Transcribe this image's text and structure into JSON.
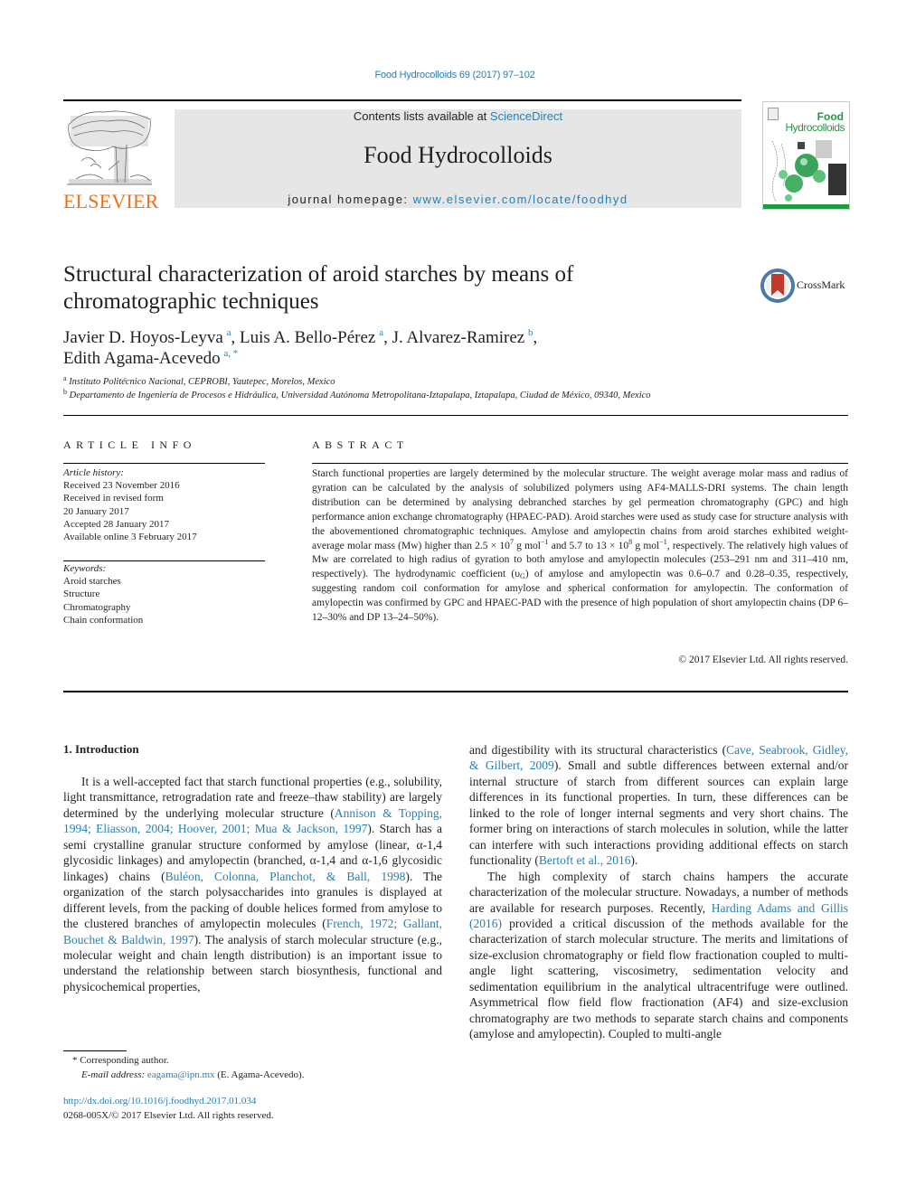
{
  "header": {
    "citation": "Food Hydrocolloids 69 (2017) 97–102",
    "contents_prefix": "Contents lists available at ",
    "contents_link": "ScienceDirect",
    "journal_title": "Food Hydrocolloids",
    "homepage_prefix": "journal homepage: ",
    "homepage_link": "www.elsevier.com/locate/foodhyd",
    "publisher_logo": "ELSEVIER",
    "cover_title_line1": "Food",
    "cover_title_line2": "Hydrocolloids",
    "crossmark_label": "CrossMark"
  },
  "colors": {
    "link": "#2a7fb0",
    "elsevier_orange": "#e9711c",
    "journal_box": "#e6e6e6",
    "cover_green": "#1f9a3c",
    "crossmark_red": "#c0392b"
  },
  "article": {
    "title": "Structural characterization of aroid starches by means of chromatographic techniques",
    "authors": [
      {
        "name": "Javier D. Hoyos-Leyva",
        "aff": "a",
        "sep": ", "
      },
      {
        "name": "Luis A. Bello-Pérez",
        "aff": "a",
        "sep": ", "
      },
      {
        "name": "J. Alvarez-Ramirez",
        "aff": "b",
        "sep": ","
      },
      {
        "name": "Edith Agama-Acevedo",
        "aff": "a, *",
        "sep": ""
      }
    ],
    "affiliations": [
      {
        "key": "a",
        "text": "Instituto Politécnico Nacional, CEPROBI, Yautepec, Morelos, Mexico"
      },
      {
        "key": "b",
        "text": "Departamento de Ingeniería de Procesos e Hidráulica, Universidad Autónoma Metropolitana-Iztapalapa, Iztapalapa, Ciudad de México, 09340, Mexico"
      }
    ]
  },
  "article_info": {
    "heading": "ARTICLE INFO",
    "history_label": "Article history:",
    "history": [
      "Received 23 November 2016",
      "Received in revised form",
      "20 January 2017",
      "Accepted 28 January 2017",
      "Available online 3 February 2017"
    ],
    "keywords_label": "Keywords:",
    "keywords": [
      "Aroid starches",
      "Structure",
      "Chromatography",
      "Chain conformation"
    ]
  },
  "abstract": {
    "heading": "ABSTRACT",
    "part1": "Starch functional properties are largely determined by the molecular structure. The weight average molar mass and radius of gyration can be calculated by the analysis of solubilized polymers using AF4-MALLS-DRI systems. The chain length distribution can be determined by analysing debranched starches by gel permeation chromatography (GPC) and high performance anion exchange chromatography (HPAEC-PAD). Aroid starches were used as study case for structure analysis with the abovementioned chromatographic techniques. Amylose and amylopectin chains from aroid starches exhibited weight-average molar mass (Mw) higher than 2.5 × 10",
    "exp1": "7",
    "part2": " g mol",
    "exp2": "−1",
    "part3": " and 5.7 to 13 × 10",
    "exp3": "8",
    "part4": " g mol",
    "exp4": "−1",
    "part5": ", respectively. The relatively high values of Mw are correlated to high radius of gyration to both amylose and amylopectin molecules (253–291 nm and 311–410 nm, respectively). The hydrodynamic coefficient (υ",
    "sub1": "G",
    "part6": ") of amylose and amylopectin was 0.6–0.7 and 0.28–0.35, respectively, suggesting random coil conformation for amylose and spherical conformation for amylopectin. The conformation of amylopectin was confirmed by GPC and HPAEC-PAD with the presence of high population of short amylopectin chains (DP 6–12–30% and DP 13–24–50%).",
    "copyright": "© 2017 Elsevier Ltd. All rights reserved."
  },
  "body": {
    "section_heading": "1.  Introduction",
    "left": {
      "t1": "It is a well-accepted fact that starch functional properties (e.g., solubility, light transmittance, retrogradation rate and freeze–thaw stability) are largely determined by the underlying molecular structure (",
      "c1": "Annison & Topping, 1994; Eliasson, 2004; Hoover, 2001; Mua & Jackson, 1997",
      "t2": "). Starch has a semi crystalline granular structure conformed by amylose (linear, α-1,4 glycosidic linkages) and amylopectin (branched, α-1,4 and α-1,6 glycosidic linkages) chains (",
      "c2": "Buléon, Colonna, Planchot, & Ball, 1998",
      "t3": "). The organization of the starch polysaccharides into granules is displayed at different levels, from the packing of double helices formed from amylose to the clustered branches of amylopectin molecules (",
      "c3": "French, 1972; Gallant, Bouchet & Baldwin, 1997",
      "t4": "). The analysis of starch molecular structure (e.g., molecular weight and chain length distribution) is an important issue to understand the relationship between starch biosynthesis, functional and physicochemical properties,"
    },
    "right": {
      "p1_t1": "and digestibility with its structural characteristics (",
      "p1_c1": "Cave, Seabrook, Gidley, & Gilbert, 2009",
      "p1_t2": "). Small and subtle differences between external and/or internal structure of starch from different sources can explain large differences in its functional properties. In turn, these differences can be linked to the role of longer internal segments and very short chains. The former bring on interactions of starch molecules in solution, while the latter can interfere with such interactions providing additional effects on starch functionality (",
      "p1_c2": "Bertoft et al., 2016",
      "p1_t3": ").",
      "p2_t1": "The high complexity of starch chains hampers the accurate characterization of the molecular structure. Nowadays, a number of methods are available for research purposes. Recently, ",
      "p2_c1": "Harding Adams and Gillis (2016)",
      "p2_t2": " provided a critical discussion of the methods available for the characterization of starch molecular structure. The merits and limitations of size-exclusion chromatography or field flow fractionation coupled to multi-angle light scattering, viscosimetry, sedimentation velocity and sedimentation equilibrium in the analytical ultracentrifuge were outlined. Asymmetrical flow field flow fractionation (AF4) and size-exclusion chromatography are two methods to separate starch chains and components (amylose and amylopectin). Coupled to multi-angle"
    }
  },
  "footnotes": {
    "corresponding": "*  Corresponding author.",
    "email_label": "E-mail address: ",
    "email": "eagama@ipn.mx",
    "email_suffix": " (E. Agama-Acevedo).",
    "doi": "http://dx.doi.org/10.1016/j.foodhyd.2017.01.034",
    "issn": "0268-005X/© 2017 Elsevier Ltd. All rights reserved."
  }
}
